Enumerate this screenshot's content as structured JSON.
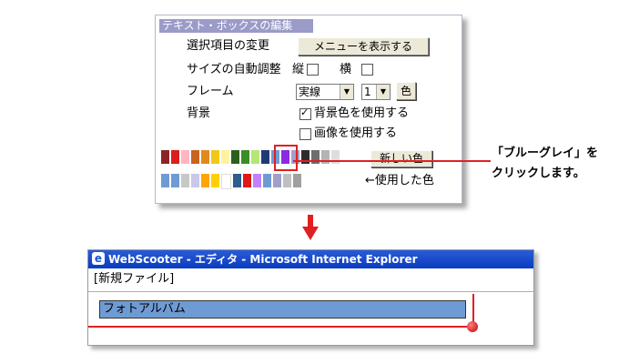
{
  "panel": {
    "title": "テキスト・ボックスの編集",
    "section_label": "選択項目の変更",
    "show_menu_button": "メニューを表示する",
    "auto_size_label": "サイズの自動調整",
    "vertical_label": "縦",
    "horizontal_label": "横",
    "frame_label": "フレーム",
    "frame_style_value": "実線",
    "frame_width_value": "1",
    "color_button": "色",
    "background_label": "背景",
    "use_bg_color_label": "背景色を使用する",
    "use_bg_color_checked": true,
    "use_image_label": "画像を使用する",
    "use_image_checked": false,
    "new_color_button": "新しい色",
    "used_colors_label": "←使用した色",
    "palette": [
      "#8b2525",
      "#d81e1e",
      "#ffb6c1",
      "#c8641e",
      "#e08a1e",
      "#f0c818",
      "#fff3a0",
      "#2d5e1e",
      "#3c8c28",
      "#b4e678",
      "#1e3a78",
      "#6f9bd4",
      "#8a2be2",
      "#a0a0c8",
      "#2c2c2c",
      "#6e6e6e",
      "#b4b4b4",
      "#dedede"
    ],
    "used_colors": [
      "#6f9bd4",
      "#6f9bd4",
      "#c8c8c8",
      "#c8c8e8",
      "#ffa500",
      "#ffd000",
      "#ffffff",
      "#2d5e90",
      "#e01818",
      "#c080ff",
      "#6f9bd4",
      "#a0a0c8",
      "#c0c0c0",
      "#a0a0a0"
    ]
  },
  "callout": {
    "line1": "「ブルーグレイ」を",
    "line2": "クリックします。"
  },
  "browser": {
    "title": "WebScooter - エディタ - Microsoft Internet Explorer",
    "file_label": "[新規ファイル]",
    "text_box": "フォトアルバム",
    "text_box_color": "#6f9bd4"
  },
  "colors": {
    "accent": "#e02020",
    "title_bar": "#0a3cbf",
    "panel_title": "#9b9bc9"
  }
}
